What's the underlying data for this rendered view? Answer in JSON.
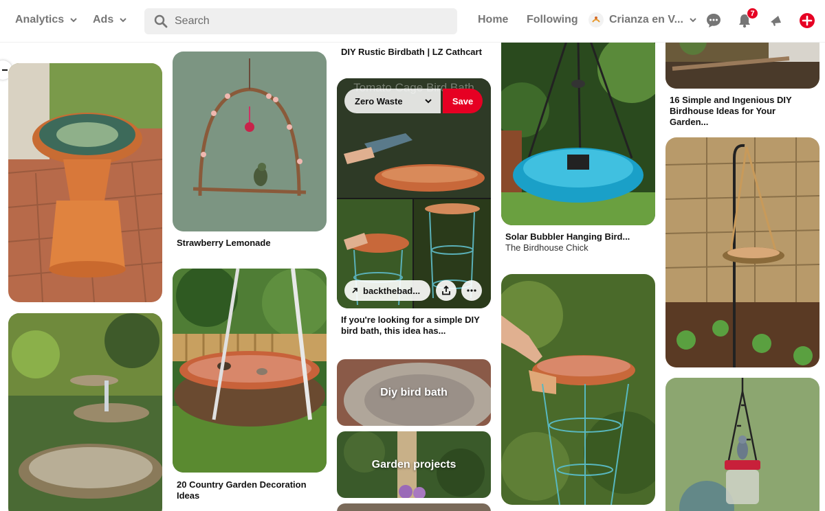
{
  "header": {
    "analytics_label": "Analytics",
    "ads_label": "Ads",
    "search_placeholder": "Search",
    "home_label": "Home",
    "following_label": "Following",
    "profile_name": "Crianza en V...",
    "notification_count": "7"
  },
  "pins": {
    "birdbath_title": "DIY Rustic Birdbath | LZ Cathcart",
    "lemonade_title": "Strawberry Lemonade",
    "country_title": "20 Country Garden Decoration Ideas",
    "simple_title": "If you're looking for a simple DIY bird bath, this idea has...",
    "tomato_overlay_text": "Tomato Cage Bird Bath",
    "diy_bird_bath_label": "Diy bird bath",
    "garden_projects_label": "Garden projects",
    "solar_title": "Solar Bubbler Hanging Bird...",
    "solar_source": "The Birdhouse Chick",
    "birdhouse_title": "16 Simple and Ingenious DIY Birdhouse Ideas for Your Garden..."
  },
  "hover": {
    "board_name": "Zero Waste",
    "save_label": "Save",
    "link_label": "backthebad..."
  },
  "colors": {
    "brand_red": "#e60023",
    "nav_gray": "#767676"
  }
}
